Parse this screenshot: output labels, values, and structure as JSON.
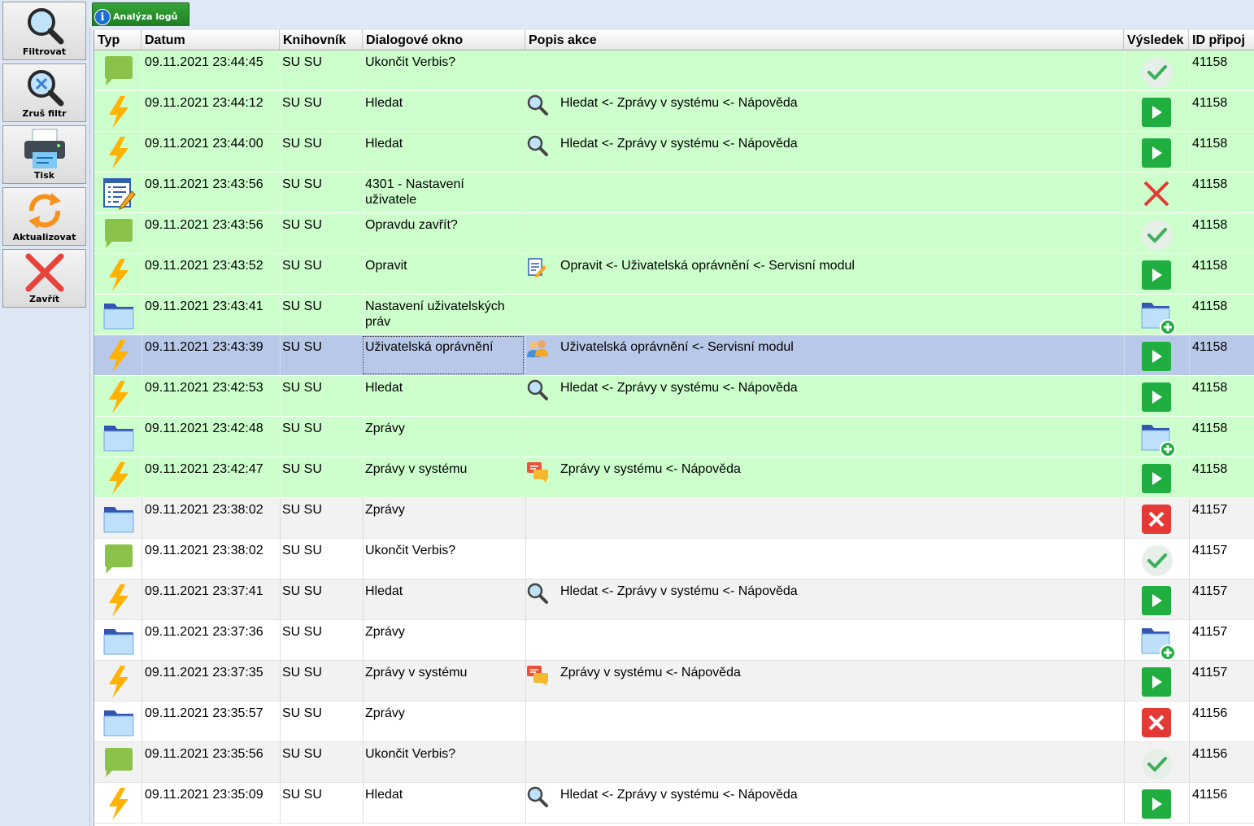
{
  "toolbar": {
    "buttons": [
      {
        "label": "Filtrovat",
        "icon": "magnifier-icon"
      },
      {
        "label": "Zruš filtr",
        "icon": "clear-filter-icon"
      },
      {
        "label": "Tisk",
        "icon": "printer-icon"
      },
      {
        "label": "Aktualizovat",
        "icon": "refresh-icon"
      },
      {
        "label": "Zavřít",
        "icon": "close-icon"
      }
    ]
  },
  "tab": {
    "label": "Analýza logů",
    "icon": "info-icon"
  },
  "columns": [
    "Typ",
    "Datum",
    "Knihovník",
    "Dialogové okno",
    "Popis akce",
    "Výsledek",
    "ID připoj"
  ],
  "colors": {
    "row_green": "#ccffcc",
    "row_selected": "#b8c8e8",
    "accent_green": "#1fae3f",
    "error_red": "#e53935"
  },
  "rows": [
    {
      "type": "message",
      "datum": "09.11.2021 23:44:45",
      "knihovnik": "SU SU",
      "okno": "Ukončit Verbis?",
      "popis": "",
      "popis_icon": "",
      "vysledek": "check",
      "id": "41158",
      "style": "green"
    },
    {
      "type": "action",
      "datum": "09.11.2021 23:44:12",
      "knihovnik": "SU SU",
      "okno": "Hledat",
      "popis": "Hledat <- Zprávy v systému <- Nápověda",
      "popis_icon": "search",
      "vysledek": "play",
      "id": "41158",
      "style": "green"
    },
    {
      "type": "action",
      "datum": "09.11.2021 23:44:00",
      "knihovnik": "SU SU",
      "okno": "Hledat",
      "popis": "Hledat <- Zprávy v systému <- Nápověda",
      "popis_icon": "search",
      "vysledek": "play",
      "id": "41158",
      "style": "green"
    },
    {
      "type": "form",
      "datum": "09.11.2021 23:43:56",
      "knihovnik": "SU SU",
      "okno": "4301 - Nastavení uživatele",
      "popis": "",
      "popis_icon": "",
      "vysledek": "cross",
      "id": "41158",
      "style": "green"
    },
    {
      "type": "message",
      "datum": "09.11.2021 23:43:56",
      "knihovnik": "SU SU",
      "okno": "Opravdu zavřít?",
      "popis": "",
      "popis_icon": "",
      "vysledek": "check",
      "id": "41158",
      "style": "green"
    },
    {
      "type": "action",
      "datum": "09.11.2021 23:43:52",
      "knihovnik": "SU SU",
      "okno": "Opravit",
      "popis": "Opravit <- Uživatelská oprávnění <- Servisní modul",
      "popis_icon": "edit",
      "vysledek": "play",
      "id": "41158",
      "style": "green"
    },
    {
      "type": "folder",
      "datum": "09.11.2021 23:43:41",
      "knihovnik": "SU SU",
      "okno": "Nastavení uživatelských práv",
      "popis": "",
      "popis_icon": "",
      "vysledek": "folder-add",
      "id": "41158",
      "style": "green"
    },
    {
      "type": "action",
      "datum": "09.11.2021 23:43:39",
      "knihovnik": "SU SU",
      "okno": "Uživatelská oprávnění",
      "popis": "Uživatelská oprávnění <- Servisní modul",
      "popis_icon": "users",
      "vysledek": "play",
      "id": "41158",
      "style": "sel"
    },
    {
      "type": "action",
      "datum": "09.11.2021 23:42:53",
      "knihovnik": "SU SU",
      "okno": "Hledat",
      "popis": "Hledat <- Zprávy v systému <- Nápověda",
      "popis_icon": "search",
      "vysledek": "play",
      "id": "41158",
      "style": "green"
    },
    {
      "type": "folder",
      "datum": "09.11.2021 23:42:48",
      "knihovnik": "SU SU",
      "okno": "Zprávy",
      "popis": "",
      "popis_icon": "",
      "vysledek": "folder-add",
      "id": "41158",
      "style": "green"
    },
    {
      "type": "action",
      "datum": "09.11.2021 23:42:47",
      "knihovnik": "SU SU",
      "okno": "Zprávy v systému",
      "popis": "Zprávy v systému <- Nápověda",
      "popis_icon": "chat",
      "vysledek": "play",
      "id": "41158",
      "style": "green"
    },
    {
      "type": "folder",
      "datum": "09.11.2021 23:38:02",
      "knihovnik": "SU SU",
      "okno": "Zprávy",
      "popis": "",
      "popis_icon": "",
      "vysledek": "error",
      "id": "41157",
      "style": "gray"
    },
    {
      "type": "message",
      "datum": "09.11.2021 23:38:02",
      "knihovnik": "SU SU",
      "okno": "Ukončit Verbis?",
      "popis": "",
      "popis_icon": "",
      "vysledek": "check",
      "id": "41157",
      "style": "white"
    },
    {
      "type": "action",
      "datum": "09.11.2021 23:37:41",
      "knihovnik": "SU SU",
      "okno": "Hledat",
      "popis": "Hledat <- Zprávy v systému <- Nápověda",
      "popis_icon": "search",
      "vysledek": "play",
      "id": "41157",
      "style": "gray"
    },
    {
      "type": "folder",
      "datum": "09.11.2021 23:37:36",
      "knihovnik": "SU SU",
      "okno": "Zprávy",
      "popis": "",
      "popis_icon": "",
      "vysledek": "folder-add",
      "id": "41157",
      "style": "white"
    },
    {
      "type": "action",
      "datum": "09.11.2021 23:37:35",
      "knihovnik": "SU SU",
      "okno": "Zprávy v systému",
      "popis": "Zprávy v systému <- Nápověda",
      "popis_icon": "chat",
      "vysledek": "play",
      "id": "41157",
      "style": "gray"
    },
    {
      "type": "folder",
      "datum": "09.11.2021 23:35:57",
      "knihovnik": "SU SU",
      "okno": "Zprávy",
      "popis": "",
      "popis_icon": "",
      "vysledek": "error",
      "id": "41156",
      "style": "white"
    },
    {
      "type": "message",
      "datum": "09.11.2021 23:35:56",
      "knihovnik": "SU SU",
      "okno": "Ukončit Verbis?",
      "popis": "",
      "popis_icon": "",
      "vysledek": "check",
      "id": "41156",
      "style": "gray"
    },
    {
      "type": "action",
      "datum": "09.11.2021 23:35:09",
      "knihovnik": "SU SU",
      "okno": "Hledat",
      "popis": "Hledat <- Zprávy v systému <- Nápověda",
      "popis_icon": "search",
      "vysledek": "play",
      "id": "41156",
      "style": "white"
    }
  ]
}
